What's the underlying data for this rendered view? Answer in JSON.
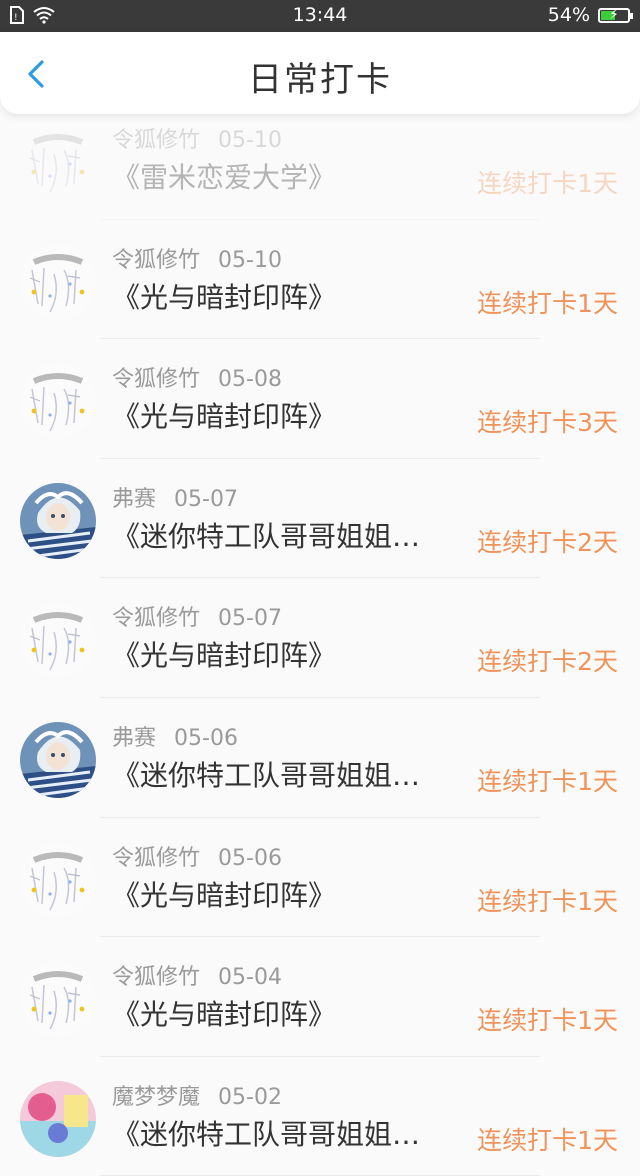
{
  "status_bar": {
    "time": "13:44",
    "battery": "54%",
    "battery_level": 0.54
  },
  "header": {
    "title": "日常打卡"
  },
  "colors": {
    "accent": "#2b9be6",
    "streak": "#f0935a"
  },
  "entries": [
    {
      "user": "令狐修竹",
      "date": "05-10",
      "book": "《雷米恋爱大学》",
      "streak": "连续打卡1天",
      "avatar": "sketch"
    },
    {
      "user": "令狐修竹",
      "date": "05-10",
      "book": "《光与暗封印阵》",
      "streak": "连续打卡1天",
      "avatar": "sketch"
    },
    {
      "user": "令狐修竹",
      "date": "05-08",
      "book": "《光与暗封印阵》",
      "streak": "连续打卡3天",
      "avatar": "sketch"
    },
    {
      "user": "弗赛",
      "date": "05-07",
      "book": "《迷你特工队哥哥姐姐…",
      "streak": "连续打卡2天",
      "avatar": "anime"
    },
    {
      "user": "令狐修竹",
      "date": "05-07",
      "book": "《光与暗封印阵》",
      "streak": "连续打卡2天",
      "avatar": "sketch"
    },
    {
      "user": "弗赛",
      "date": "05-06",
      "book": "《迷你特工队哥哥姐姐…",
      "streak": "连续打卡1天",
      "avatar": "anime"
    },
    {
      "user": "令狐修竹",
      "date": "05-06",
      "book": "《光与暗封印阵》",
      "streak": "连续打卡1天",
      "avatar": "sketch"
    },
    {
      "user": "令狐修竹",
      "date": "05-04",
      "book": "《光与暗封印阵》",
      "streak": "连续打卡1天",
      "avatar": "sketch"
    },
    {
      "user": "魔梦梦魔",
      "date": "05-02",
      "book": "《迷你特工队哥哥姐姐…",
      "streak": "连续打卡1天",
      "avatar": "colorful"
    }
  ]
}
